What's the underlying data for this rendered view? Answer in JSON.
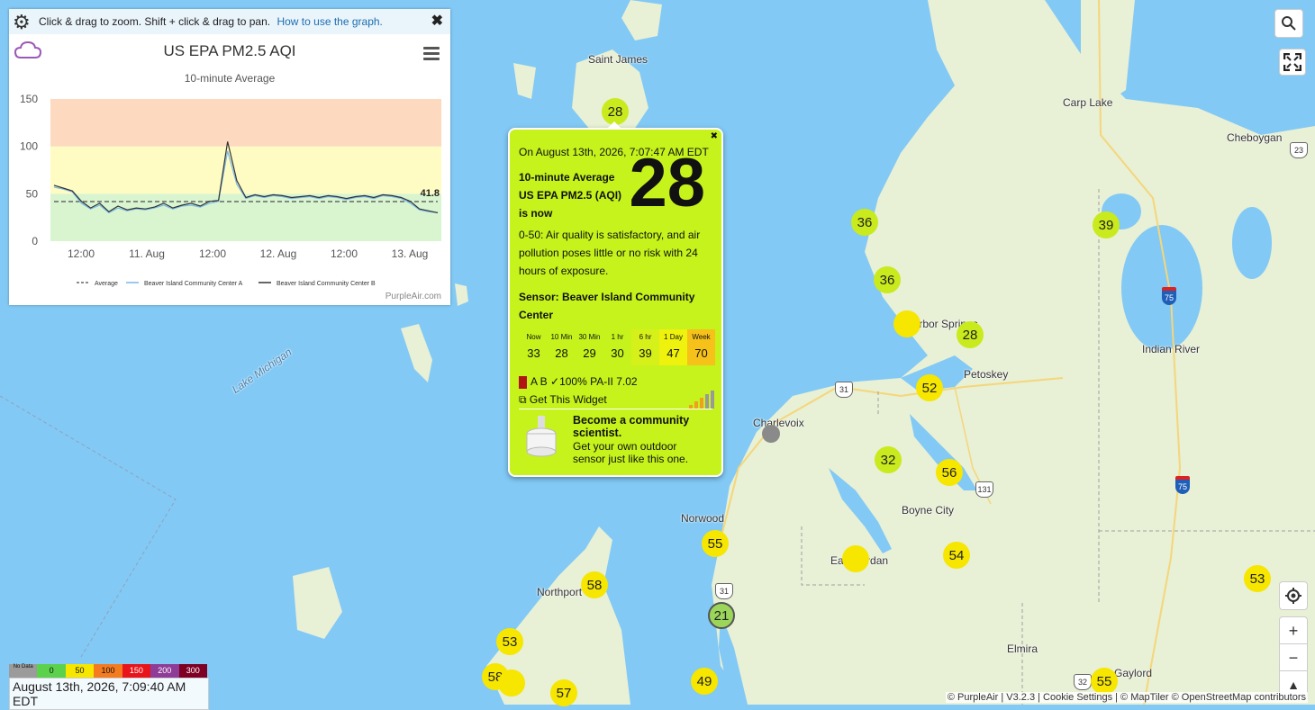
{
  "graph": {
    "hint": "Click & drag to zoom. Shift + click & drag to pan.",
    "help_link": "How to use the graph.",
    "close_icon": "close-icon",
    "settings_icon": "gear-icon",
    "title": "US EPA PM2.5 AQI",
    "subtitle": "10-minute Average",
    "credit": "PurpleAir.com",
    "legend": [
      "Average",
      "Beaver Island Community Center A",
      "Beaver Island Community Center B"
    ]
  },
  "chart_data": {
    "type": "line",
    "title": "US EPA PM2.5 AQI",
    "subtitle": "10-minute Average",
    "y_ticks": [
      0,
      50,
      100,
      150
    ],
    "ylim": [
      0,
      150
    ],
    "x_ticks": [
      "12:00",
      "11. Aug",
      "12:00",
      "12. Aug",
      "12:00",
      "13. Aug"
    ],
    "bands": [
      {
        "from": 0,
        "to": 50,
        "color": "#d8f5d0"
      },
      {
        "from": 50,
        "to": 100,
        "color": "#fefcc2"
      },
      {
        "from": 100,
        "to": 150,
        "color": "#fdd9bf"
      }
    ],
    "average": 41.8,
    "series": [
      {
        "name": "Average",
        "style": "dashed",
        "color": "#666666",
        "values": [
          41.8,
          41.8,
          41.8,
          41.8,
          41.8,
          41.8,
          41.8,
          41.8
        ]
      },
      {
        "name": "Beaver Island Community Center A",
        "color": "#7ab7e8",
        "values": [
          57,
          55,
          52,
          40,
          34,
          38,
          30,
          35,
          32,
          34,
          33,
          35,
          38,
          34,
          37,
          38,
          36,
          40,
          42,
          95,
          60,
          45,
          48,
          46,
          48,
          47,
          45,
          46,
          47,
          45,
          47,
          46,
          44,
          46,
          47,
          45,
          48,
          47,
          45,
          40,
          33,
          31,
          30
        ]
      },
      {
        "name": "Beaver Island Community Center B",
        "color": "#333333",
        "values": [
          59,
          56,
          53,
          42,
          35,
          40,
          31,
          37,
          33,
          35,
          34,
          36,
          40,
          35,
          38,
          40,
          37,
          42,
          43,
          105,
          64,
          46,
          49,
          47,
          49,
          48,
          46,
          47,
          48,
          46,
          48,
          47,
          45,
          47,
          48,
          46,
          49,
          48,
          46,
          42,
          34,
          32,
          30
        ]
      }
    ]
  },
  "popup": {
    "time": "On August 13th, 2026, 7:07:47 AM EDT",
    "label": "10-minute Average US EPA PM2.5 (AQI) is now",
    "value": "28",
    "description": "0-50: Air quality is satisfactory, and air pollution poses little or no risk with 24 hours of exposure.",
    "sensor": "Sensor: Beaver Island Community Center",
    "history": [
      {
        "label": "Now",
        "value": "33",
        "color": "#c5f31b"
      },
      {
        "label": "10 Min",
        "value": "28",
        "color": "#c5f31b"
      },
      {
        "label": "30 Min",
        "value": "29",
        "color": "#c5f31b"
      },
      {
        "label": "1 hr",
        "value": "30",
        "color": "#c5f31b"
      },
      {
        "label": "6 hr",
        "value": "39",
        "color": "#d6f01a"
      },
      {
        "label": "1 Day",
        "value": "47",
        "color": "#eef20c"
      },
      {
        "label": "Week",
        "value": "70",
        "color": "#f6c21a"
      }
    ],
    "status": "A B ✓100% PA-II 7.02",
    "widget": "Get This Widget",
    "promo_title": "Become a community scientist.",
    "promo_text": "Get your own outdoor sensor just like this one."
  },
  "places": [
    {
      "name": "Saint James"
    },
    {
      "name": "Carp Lake"
    },
    {
      "name": "Cheboygan"
    },
    {
      "name": "Harbor Springs"
    },
    {
      "name": "Petoskey"
    },
    {
      "name": "Indian River"
    },
    {
      "name": "Charlevoix"
    },
    {
      "name": "Norwood"
    },
    {
      "name": "Boyne City"
    },
    {
      "name": "East Jordan"
    },
    {
      "name": "Northport"
    },
    {
      "name": "Elmira"
    },
    {
      "name": "Gaylord"
    },
    {
      "name": "Lake Michigan"
    }
  ],
  "markers": [
    {
      "value": "28",
      "level": "green"
    },
    {
      "value": "36",
      "level": "green"
    },
    {
      "value": "36",
      "level": "green"
    },
    {
      "value": "39",
      "level": "green"
    },
    {
      "value": "28",
      "level": "green"
    },
    {
      "value": "",
      "level": "yellow"
    },
    {
      "value": "52",
      "level": "yellow"
    },
    {
      "value": "32",
      "level": "green"
    },
    {
      "value": "56",
      "level": "yellow"
    },
    {
      "value": "55",
      "level": "yellow"
    },
    {
      "value": "54",
      "level": "yellow"
    },
    {
      "value": "",
      "level": "yellow"
    },
    {
      "value": "53",
      "level": "yellow"
    },
    {
      "value": "58",
      "level": "yellow"
    },
    {
      "value": "21",
      "level": "lgreen"
    },
    {
      "value": "53",
      "level": "yellow"
    },
    {
      "value": "58",
      "level": "yellow"
    },
    {
      "value": "",
      "level": "yellow"
    },
    {
      "value": "49",
      "level": "yellow"
    },
    {
      "value": "57",
      "level": "yellow"
    },
    {
      "value": "55",
      "level": "yellow"
    },
    {
      "value": "",
      "level": "gray"
    }
  ],
  "shields": [
    "31",
    "131",
    "31",
    "32",
    "75",
    "75",
    "23"
  ],
  "controls": {
    "search_icon": "search-icon",
    "fullscreen_icon": "fullscreen-icon",
    "locate_icon": "locate-icon",
    "zoom_in": "+",
    "zoom_out": "−",
    "compass_icon": "compass-icon"
  },
  "legend": {
    "items": [
      {
        "label": "No Data",
        "color": "#9b9b9b"
      },
      {
        "label": "0",
        "color": "#5bd14c"
      },
      {
        "label": "50",
        "color": "#f6e600"
      },
      {
        "label": "100",
        "color": "#f47b20"
      },
      {
        "label": "150",
        "color": "#e8151b"
      },
      {
        "label": "200",
        "color": "#8e3c97"
      },
      {
        "label": "300",
        "color": "#7e0023"
      }
    ],
    "time": "August 13th, 2026, 7:09:40 AM EDT"
  },
  "attribution": "© PurpleAir | V3.2.3 | Cookie Settings | © MapTiler © OpenStreetMap contributors"
}
